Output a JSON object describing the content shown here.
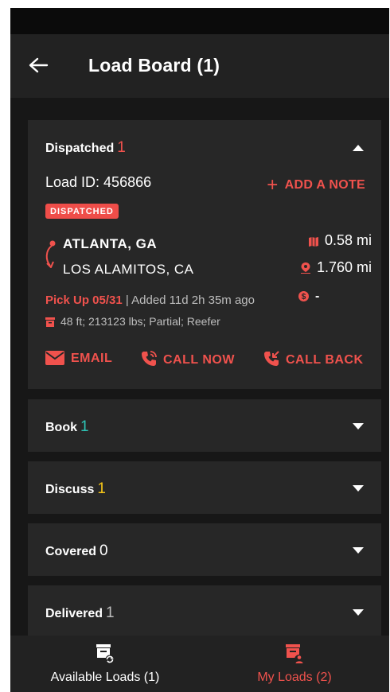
{
  "app": {
    "title": "Load Board (1)"
  },
  "sections": {
    "dispatched": {
      "label": "Dispatched",
      "count": "1",
      "count_color": "#f0524d",
      "expanded": true
    },
    "book": {
      "label": "Book",
      "count": "1",
      "count_color": "#2ec4b6",
      "expanded": false
    },
    "discuss": {
      "label": "Discuss",
      "count": "1",
      "count_color": "#f5c518",
      "expanded": false
    },
    "covered": {
      "label": "Covered",
      "count": "0",
      "count_color": "#ffffff",
      "expanded": false
    },
    "delivered": {
      "label": "Delivered",
      "count": "1",
      "count_color": "#bdbdbd",
      "expanded": false
    }
  },
  "load": {
    "id_text": "Load ID: 456866",
    "add_note_label": "ADD A NOTE",
    "status_badge": "DISPATCHED",
    "origin": "ATLANTA, GA",
    "destination": "LOS ALAMITOS, CA",
    "deadhead": "0.58 mi",
    "distance": "1.760 mi",
    "pickup": "Pick Up 05/31",
    "added": "| Added 11d 2h 35m ago",
    "rate": "-",
    "specs": "48 ft; 213123 lbs; Partial; Reefer",
    "actions": {
      "email": "EMAIL",
      "call_now": "CALL NOW",
      "call_back": "CALL BACK"
    }
  },
  "bottom_nav": {
    "available": {
      "label": "Available Loads (1)",
      "active": false
    },
    "my_loads": {
      "label": "My Loads (2)",
      "active": true
    }
  },
  "colors": {
    "accent": "#f0524d",
    "background": "#171717",
    "card": "#272727",
    "appbar": "#222222"
  },
  "icons": [
    "back-arrow-icon",
    "caret-up-icon",
    "caret-down-icon",
    "plus-icon",
    "route-icon",
    "map-icon",
    "location-pin-icon",
    "dollar-icon",
    "trailer-icon",
    "email-icon",
    "phone-icon",
    "phone-callback-icon",
    "truck-refresh-icon",
    "truck-user-icon"
  ]
}
